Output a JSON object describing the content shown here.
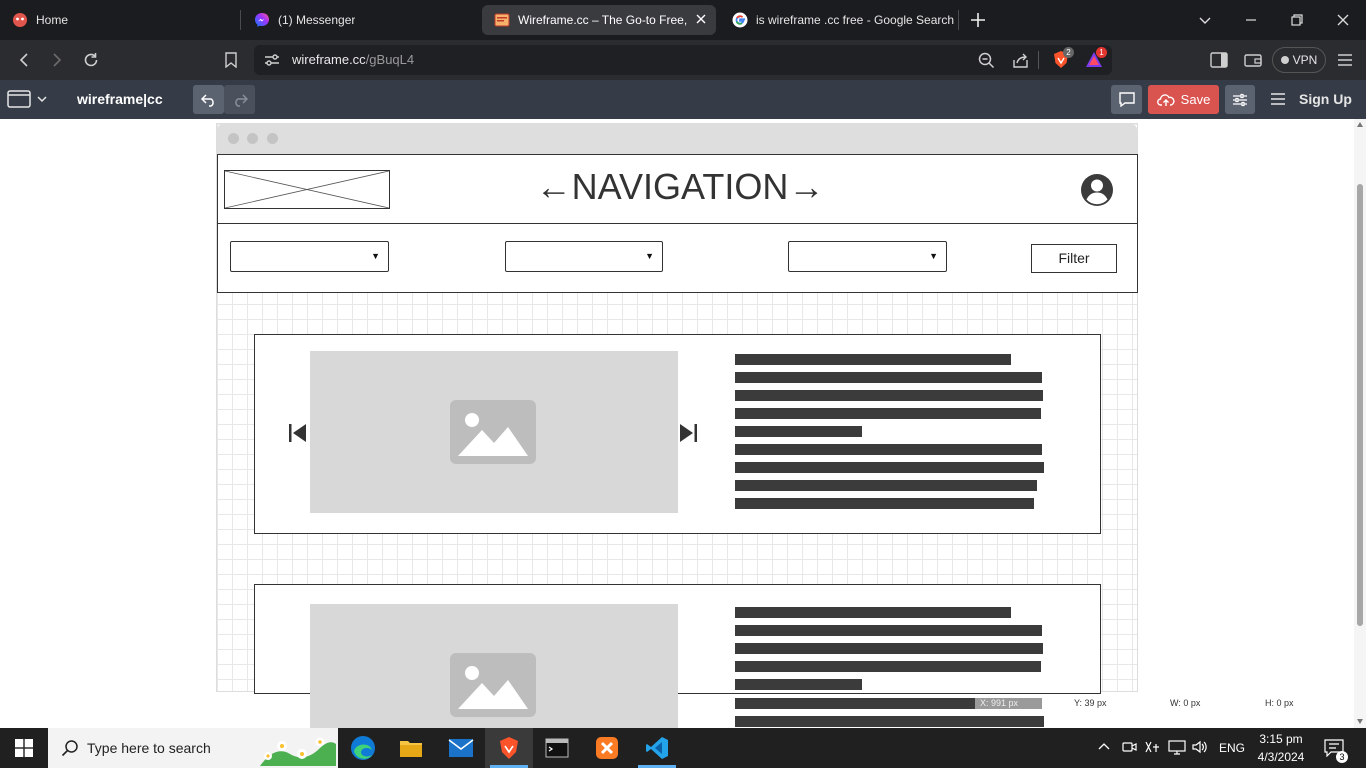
{
  "browser": {
    "tabs": [
      {
        "label": "Home",
        "icon": "brave-home-icon",
        "color": "#e0564d"
      },
      {
        "label": "(1) Messenger",
        "icon": "messenger-icon",
        "color": "#a34bf1"
      },
      {
        "label": "Wireframe.cc – The Go-to Free, O",
        "icon": "wireframe-icon",
        "color": "#f07c3a"
      },
      {
        "label": "is wireframe .cc free - Google Search",
        "icon": "google-icon",
        "color": "#4285f4"
      }
    ],
    "address": {
      "host": "wireframe.cc",
      "path": "/gBuqL4"
    },
    "shield_count": "2",
    "rewards_count": "1",
    "vpn_label": "VPN"
  },
  "app": {
    "brand": "wireframe|cc",
    "save_label": "Save",
    "signup_label": "Sign Up",
    "accent": "#d9534f"
  },
  "wireframe": {
    "nav_title": "←NAVIGATION→",
    "filter_label": "Filter",
    "selects": [
      "",
      "",
      ""
    ]
  },
  "status": {
    "x": "X: 991 px",
    "y": "Y: 39 px",
    "w": "W: 0 px",
    "h": "H: 0 px"
  },
  "taskbar": {
    "search_placeholder": "Type here to search",
    "lang": "ENG",
    "time": "3:15 pm",
    "date": "4/3/2024",
    "notifications": "3"
  }
}
